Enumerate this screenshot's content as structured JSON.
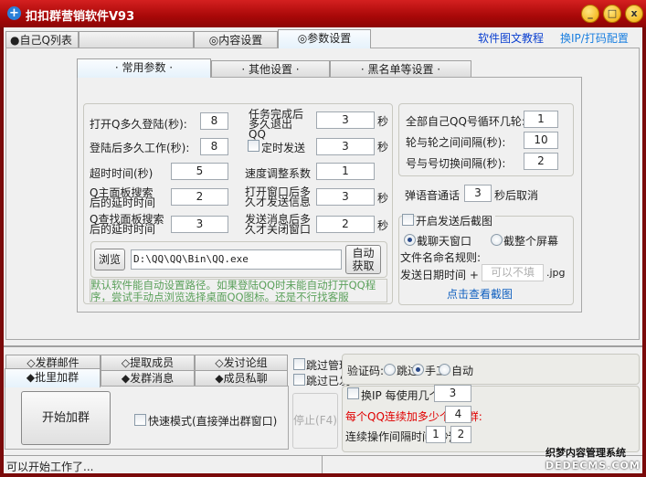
{
  "window": {
    "title": "扣扣群营销软件V93",
    "minimize": "_",
    "maximize": "□",
    "close": "x"
  },
  "top_tabs": [
    {
      "label": "●自己Q列表"
    },
    {
      "label": ""
    },
    {
      "label": "◎内容设置"
    },
    {
      "label": "◎参数设置"
    }
  ],
  "top_links": {
    "tutorial": "软件图文教程",
    "ip_config": "换IP/打码配置"
  },
  "sub_tabs": [
    {
      "label": "· 常用参数 ·"
    },
    {
      "label": "· 其他设置 ·"
    },
    {
      "label": "· 黑名单等设置 ·"
    }
  ],
  "params_left": [
    {
      "label": "打开Q多久登陆(秒):",
      "value": "8"
    },
    {
      "label": "登陆后多久工作(秒):",
      "value": "8"
    },
    {
      "label": "超时时间(秒)",
      "value": "5"
    },
    {
      "label": "Q主面板搜索后的延时时间",
      "value": "2"
    },
    {
      "label": "Q查找面板搜索后的延时时间",
      "value": "3"
    }
  ],
  "params_mid": [
    {
      "label": "任务完成后多久退出QQ",
      "value": "3",
      "unit": "秒"
    },
    {
      "label": "定时发送",
      "value": "3",
      "unit": "秒",
      "checked": false
    },
    {
      "label": "速度调整系数",
      "value": "1",
      "unit": ""
    },
    {
      "label": "打开窗口后多久才发送信息",
      "value": "3",
      "unit": "秒"
    },
    {
      "label": "发送消息后多久才关闭窗口",
      "value": "2",
      "unit": "秒"
    }
  ],
  "path": {
    "browse": "浏览",
    "value": "D:\\QQ\\QQ\\Bin\\QQ.exe",
    "auto": "自动获取"
  },
  "note": "默认软件能自动设置路径。如果登陆QQ时未能自动打开QQ程序，尝试手动点浏览选择桌面QQ图标。还是不行找客服",
  "loop": [
    {
      "label": "全部自己QQ号循环几轮:",
      "value": "1"
    },
    {
      "label": "轮与轮之间间隔(秒):",
      "value": "10"
    },
    {
      "label": "号与号切换间隔(秒):",
      "value": "2"
    }
  ],
  "voice": {
    "prefix": "弹语音通话",
    "value": "3",
    "suffix": "秒后取消"
  },
  "screenshot": {
    "enable_label": "开启发送后截图",
    "enabled": false,
    "opt_chat": "截聊天窗口",
    "opt_screen": "截整个屏幕",
    "selected": "chat",
    "rule_label": "文件名命名规则:",
    "date_label": "发送日期时间  +",
    "name_placeholder": "可以不填",
    "ext": ".jpg",
    "view_link": "点击查看截图"
  },
  "bottom_tabs_row1": [
    {
      "label": "◇发群邮件"
    },
    {
      "label": "◇提取成员"
    },
    {
      "label": "◇发讨论组"
    }
  ],
  "bottom_tabs_row2": [
    {
      "label": "◆批里加群"
    },
    {
      "label": "◆发群消息"
    },
    {
      "label": "◆成员私聊"
    }
  ],
  "start_button": "开始加群",
  "quick_mode": {
    "label": "快速模式(直接弹出群窗口)",
    "checked": false
  },
  "skip_admin": {
    "label": "跳过管理",
    "checked": false
  },
  "skip_sent": {
    "label": "跳过已发",
    "checked": false
  },
  "stop_button": "停止(F4)",
  "captcha": {
    "label": "验证码:",
    "options": [
      "跳过",
      "手工",
      "自动"
    ],
    "selected": "手工"
  },
  "change_ip": {
    "label": "换IP  每使用几个Q:",
    "value": "3",
    "checked": false
  },
  "groups_per_qq": {
    "label": "每个QQ连续加多少个QQ群:",
    "value": "4",
    "color": "#e00000"
  },
  "interval": {
    "label": "连续操作间隔时间(秒)",
    "min": "1",
    "dash": "-",
    "max": "2"
  },
  "status": {
    "text": "可以开始工作了..."
  },
  "watermark": {
    "line1": "织梦内容管理系统",
    "line2": "DEDECMS.COM"
  }
}
